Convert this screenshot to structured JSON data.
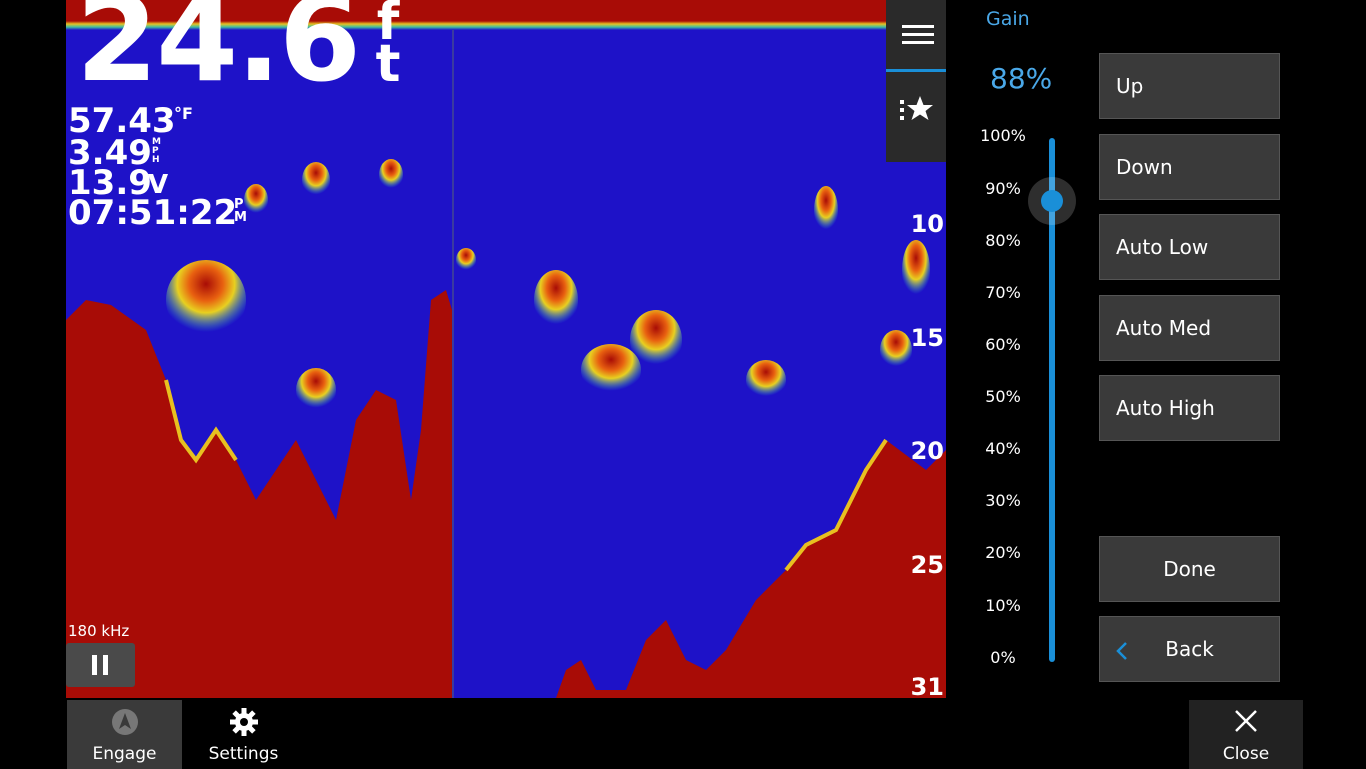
{
  "sonar": {
    "depth_value": "24.6",
    "depth_unit_1": "f",
    "depth_unit_2": "t",
    "water_temp": "57.43",
    "water_temp_unit": "°F",
    "speed": "3.49",
    "speed_unit_1": "M",
    "speed_unit_2": "P",
    "speed_unit_3": "H",
    "voltage": "13.9",
    "voltage_unit": "V",
    "time": "07:51:22",
    "time_unit_1": "P",
    "time_unit_2": "M",
    "frequency": "180 kHz",
    "depth_scale": [
      "10",
      "15",
      "20",
      "25",
      "31"
    ],
    "colors": {
      "background": "#1e12c8",
      "bottom": "#a80c06",
      "surface_band": "#e8c020"
    }
  },
  "side_tabs": {
    "menu_icon": "hamburger-icon",
    "favorites_icon": "favorites-star-icon"
  },
  "gain": {
    "title": "Gain",
    "value": "88%",
    "level_fraction": 0.88,
    "scale": [
      "100%",
      "90%",
      "80%",
      "70%",
      "60%",
      "50%",
      "40%",
      "30%",
      "20%",
      "10%",
      "0%"
    ],
    "buttons": {
      "up": "Up",
      "down": "Down",
      "auto_low": "Auto Low",
      "auto_med": "Auto Med",
      "auto_high": "Auto High",
      "done": "Done",
      "back": "Back"
    },
    "accent_color": "#1a8fd8"
  },
  "bottom_bar": {
    "engage": "Engage",
    "settings": "Settings",
    "close": "Close"
  }
}
